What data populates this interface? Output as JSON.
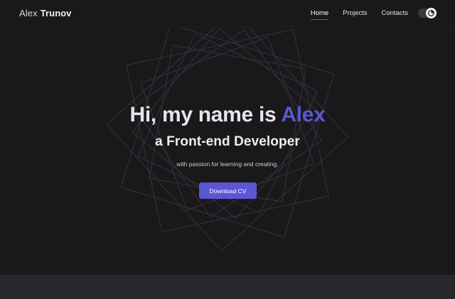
{
  "header": {
    "logo_first": "Alex",
    "logo_last": "Trunov",
    "nav": [
      {
        "label": "Home",
        "active": true
      },
      {
        "label": "Projects",
        "active": false
      },
      {
        "label": "Contacts",
        "active": false
      }
    ],
    "theme_toggle_icon": "moon-icon"
  },
  "hero": {
    "title_prefix": "Hi, my name is",
    "title_name": "Alex",
    "subtitle": "a Front-end Developer",
    "description": "with passion for learning and creating.",
    "button_label": "Download CV"
  },
  "colors": {
    "background": "#1a181b",
    "accent": "#5b57d3",
    "text": "#e7e5e9",
    "lower_section": "#29272b"
  }
}
